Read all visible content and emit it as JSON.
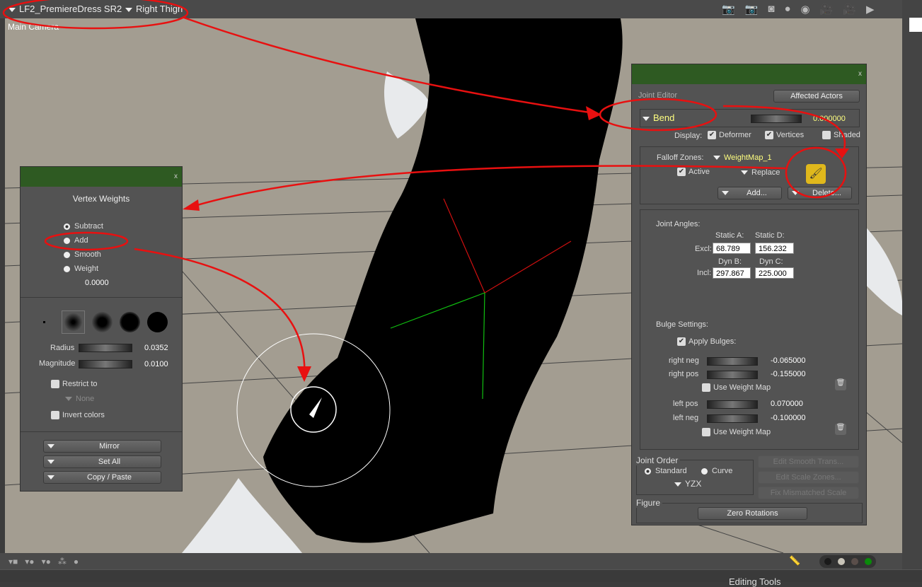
{
  "topbar": {
    "figure": "LF2_PremiereDress SR2",
    "actor": "Right Thigh",
    "camera_label": "Main Camera",
    "icons": [
      "camera-icon",
      "camera-frame-icon",
      "render-preview-icon",
      "sphere-icon",
      "trackball-icon",
      "flyaround-camera-icon",
      "camera-move-icon",
      "more-arrow-icon"
    ]
  },
  "vertex_weights": {
    "title": "Vertex Weights",
    "close": "x",
    "modes": [
      "Subtract",
      "Add",
      "Smooth",
      "Weight"
    ],
    "selected_mode": "Subtract",
    "weight_value": "0.0000",
    "radius_label": "Radius",
    "radius_value": "0.0352",
    "magnitude_label": "Magnitude",
    "magnitude_value": "0.0100",
    "restrict_label": "Restrict to",
    "restrict_option": "None",
    "invert_label": "Invert colors",
    "mirror": "Mirror",
    "set_all": "Set All",
    "copy_paste": "Copy / Paste"
  },
  "joint_editor": {
    "close": "x",
    "title": "Joint Editor",
    "affected_actors": "Affected Actors",
    "bend": "Bend",
    "bend_value": "0.000000",
    "display_label": "Display:",
    "deformer": "Deformer",
    "vertices": "Vertices",
    "shaded": "Shaded",
    "falloff_label": "Falloff Zones:",
    "falloff_value": "WeightMap_1",
    "active": "Active",
    "replace": "Replace",
    "add": "Add...",
    "delete": "Delete...",
    "joint_angles": "Joint Angles:",
    "static_a": "Static A:",
    "static_d": "Static D:",
    "excl": "Excl:",
    "static_a_val": "68.789",
    "static_d_val": "156.232",
    "dyn_b": "Dyn B:",
    "dyn_c": "Dyn C:",
    "incl": "Incl:",
    "dyn_b_val": "297.867",
    "dyn_c_val": "225.000",
    "bulge_settings": "Bulge Settings:",
    "apply_bulges": "Apply Bulges:",
    "right_neg": "right neg",
    "right_neg_val": "-0.065000",
    "right_pos": "right pos",
    "right_pos_val": "-0.155000",
    "use_weight_map": "Use Weight Map",
    "left_pos": "left pos",
    "left_pos_val": "0.070000",
    "left_neg": "left neg",
    "left_neg_val": "-0.100000",
    "joint_order": "Joint Order",
    "standard": "Standard",
    "curve": "Curve",
    "order": "YZX",
    "edit_smooth": "Edit Smooth Trans...",
    "edit_scale": "Edit Scale Zones...",
    "fix_scale": "Fix Mismatched Scale",
    "figure": "Figure",
    "zero_rotations": "Zero Rotations"
  },
  "bottom": {
    "editing_tools": "Editing Tools",
    "colors": [
      "#1a1a1a",
      "#c8c4b8",
      "#5a4e4a",
      "#0a8a0a"
    ]
  },
  "annotation_color": "#e81010"
}
